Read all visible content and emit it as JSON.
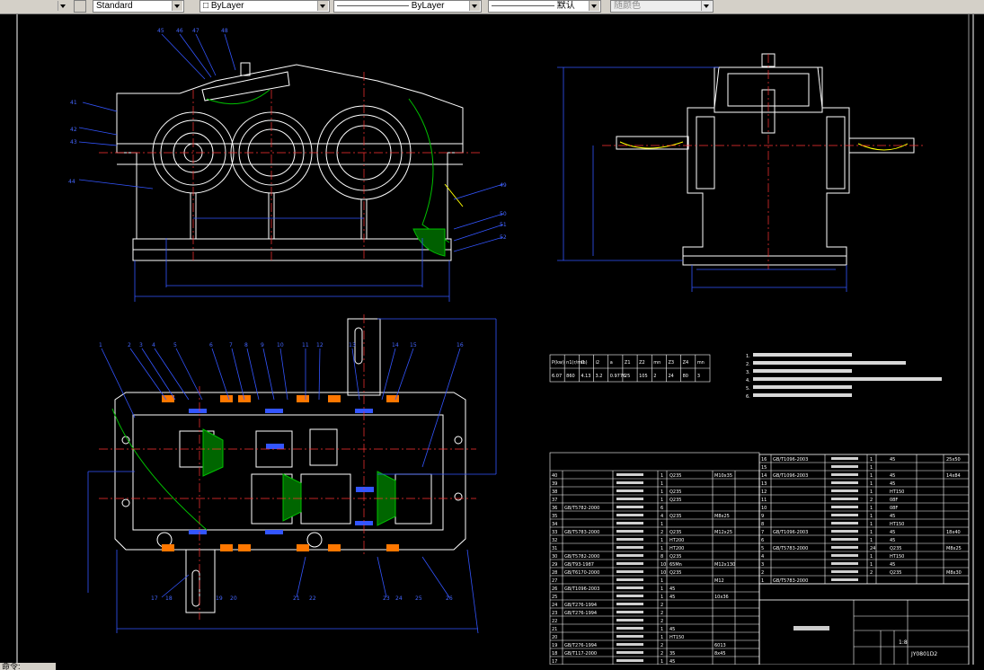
{
  "toolbar": {
    "textstyle": "Standard",
    "layer": "ByLayer",
    "linetype": "ByLayer",
    "lineweight": "默认",
    "plotstyle": "随颜色"
  },
  "param_table": {
    "headers": [
      "P(kw)",
      "n1(r/min)",
      "i1",
      "i2",
      "a",
      "Z1",
      "Z2",
      "mn",
      "Z3",
      "Z4",
      "mn"
    ],
    "values": [
      "6.07",
      "860",
      "4.13",
      "3.2",
      "0.9776",
      "25",
      "105",
      "2",
      "24",
      "80",
      "3"
    ]
  },
  "tech_notes": [
    "1.",
    "2.",
    "3.",
    "4.",
    "5.",
    "6."
  ],
  "bom_left": {
    "rows": [
      {
        "no": "40",
        "code": "",
        "qty": "1",
        "mat": "Q235"
      },
      {
        "no": "39",
        "code": "",
        "qty": "1",
        "mat": ""
      },
      {
        "no": "38",
        "code": "",
        "qty": "1",
        "mat": "Q235"
      },
      {
        "no": "37",
        "code": "",
        "qty": "1",
        "mat": "Q235"
      },
      {
        "no": "36",
        "code": "GB/T5782-2000",
        "qty": "6",
        "mat": ""
      },
      {
        "no": "35",
        "code": "",
        "qty": "4",
        "mat": "Q235"
      },
      {
        "no": "34",
        "code": "",
        "qty": "1",
        "mat": ""
      },
      {
        "no": "33",
        "code": "GB/T5783-2000",
        "qty": "2",
        "mat": "Q235"
      },
      {
        "no": "32",
        "code": "",
        "qty": "1",
        "mat": "HT200"
      },
      {
        "no": "31",
        "code": "",
        "qty": "1",
        "mat": "HT200"
      },
      {
        "no": "30",
        "code": "GB/T5782-2000",
        "qty": "8",
        "mat": "Q235"
      },
      {
        "no": "29",
        "code": "GB/T93-1987",
        "qty": "10",
        "mat": "65Mn"
      },
      {
        "no": "28",
        "code": "GB/T6170-2000",
        "qty": "10",
        "mat": "Q235"
      },
      {
        "no": "27",
        "code": "",
        "qty": "1",
        "mat": ""
      },
      {
        "no": "26",
        "code": "GB/T1096-2003",
        "qty": "1",
        "mat": "45"
      },
      {
        "no": "25",
        "code": "",
        "qty": "1",
        "mat": "45"
      },
      {
        "no": "24",
        "code": "GB/T276-1994",
        "qty": "2",
        "mat": ""
      },
      {
        "no": "23",
        "code": "GB/T276-1994",
        "qty": "2",
        "mat": ""
      },
      {
        "no": "22",
        "code": "",
        "qty": "2",
        "mat": ""
      },
      {
        "no": "21",
        "code": "",
        "qty": "1",
        "mat": "45"
      },
      {
        "no": "20",
        "code": "",
        "qty": "1",
        "mat": "HT150"
      },
      {
        "no": "19",
        "code": "GB/T276-1994",
        "qty": "2",
        "mat": ""
      },
      {
        "no": "18",
        "code": "GB/T117-2000",
        "qty": "2",
        "mat": "35"
      },
      {
        "no": "17",
        "code": "",
        "qty": "1",
        "mat": "45"
      }
    ],
    "specs": [
      "M10x35",
      "",
      "",
      "",
      "",
      "M8x25",
      "",
      "M12x25",
      "",
      "",
      "",
      "M12x130",
      "",
      "M12",
      "",
      "10x36",
      "",
      "",
      "",
      "",
      "",
      "6013",
      "8x45",
      ""
    ]
  },
  "bom_right": {
    "rows": [
      {
        "no": "16",
        "code": "GB/T1096-2003",
        "qty": "1",
        "mat": "45",
        "note": "25x50"
      },
      {
        "no": "15",
        "code": "",
        "qty": "1",
        "mat": "",
        "note": ""
      },
      {
        "no": "14",
        "code": "GB/T1096-2003",
        "qty": "1",
        "mat": "45",
        "note": "14x84"
      },
      {
        "no": "13",
        "code": "",
        "qty": "1",
        "mat": "45",
        "note": ""
      },
      {
        "no": "12",
        "code": "",
        "qty": "1",
        "mat": "HT150",
        "note": ""
      },
      {
        "no": "11",
        "code": "",
        "qty": "2",
        "mat": "08F",
        "note": ""
      },
      {
        "no": "10",
        "code": "",
        "qty": "1",
        "mat": "08F",
        "note": ""
      },
      {
        "no": "9",
        "code": "",
        "qty": "1",
        "mat": "45",
        "note": ""
      },
      {
        "no": "8",
        "code": "",
        "qty": "1",
        "mat": "HT150",
        "note": ""
      },
      {
        "no": "7",
        "code": "GB/T1096-2003",
        "qty": "1",
        "mat": "45",
        "note": "18x40"
      },
      {
        "no": "6",
        "code": "",
        "qty": "1",
        "mat": "45",
        "note": ""
      },
      {
        "no": "5",
        "code": "GB/T5783-2000",
        "qty": "24",
        "mat": "Q235",
        "note": "M8x25"
      },
      {
        "no": "4",
        "code": "",
        "qty": "1",
        "mat": "HT150",
        "note": ""
      },
      {
        "no": "3",
        "code": "",
        "qty": "1",
        "mat": "45",
        "note": ""
      },
      {
        "no": "2",
        "code": "",
        "qty": "2",
        "mat": "Q235",
        "note": "M8x30"
      },
      {
        "no": "1",
        "code": "GB/T5783-2000",
        "qty": "",
        "mat": "",
        "note": ""
      }
    ]
  },
  "title_block": {
    "scale": "1:8",
    "drawing_no": "JY0801D2"
  },
  "command_line": "命令: "
}
